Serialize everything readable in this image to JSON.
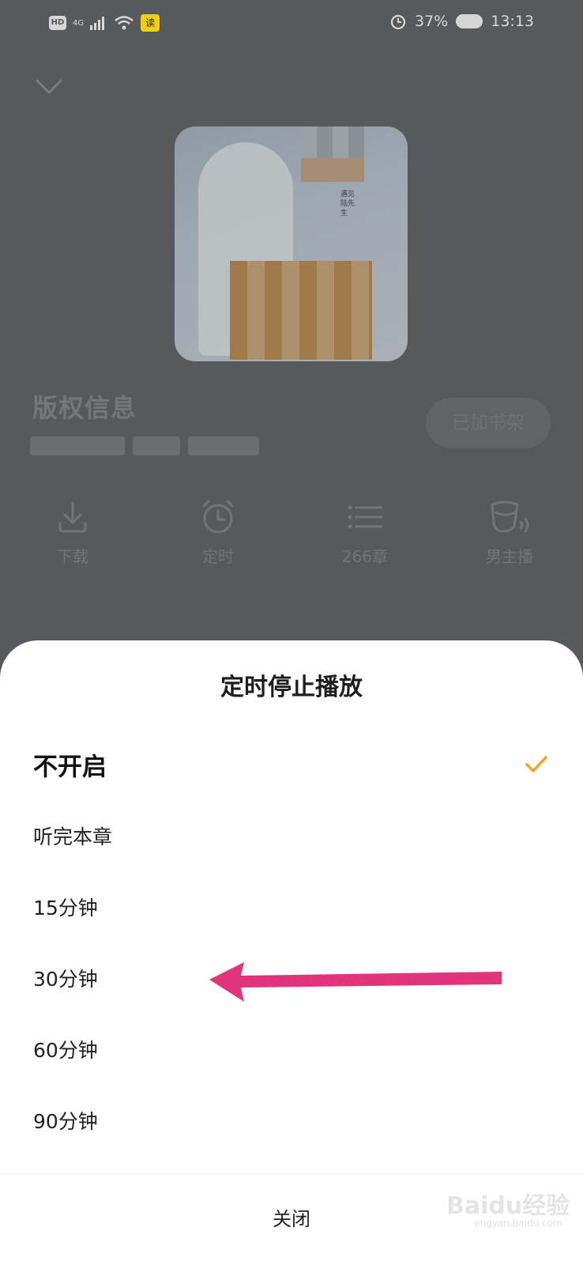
{
  "status_bar": {
    "hd_label": "HD",
    "network_label": "4G",
    "app_badge": "读",
    "battery_percent": "37%",
    "time": "13:13"
  },
  "player": {
    "cover_title_lines": [
      "遇见",
      "陆先生"
    ],
    "book_title": "版权信息",
    "shelf_button": "已加书架",
    "actions": [
      {
        "label": "下载",
        "icon": "download-icon"
      },
      {
        "label": "定时",
        "icon": "alarm-clock-icon"
      },
      {
        "label": "266章",
        "icon": "chapter-list-icon"
      },
      {
        "label": "男主播",
        "icon": "narrator-icon"
      }
    ]
  },
  "timer_sheet": {
    "title": "定时停止播放",
    "options": [
      {
        "label": "不开启",
        "selected": true
      },
      {
        "label": "听完本章",
        "selected": false
      },
      {
        "label": "15分钟",
        "selected": false
      },
      {
        "label": "30分钟",
        "selected": false
      },
      {
        "label": "60分钟",
        "selected": false
      },
      {
        "label": "90分钟",
        "selected": false
      }
    ],
    "close_label": "关闭"
  },
  "watermark": {
    "main": "Baidu经验",
    "sub": "jingyan.baidu.com"
  },
  "colors": {
    "accent": "#f0a32a",
    "annotation_arrow": "#e2347a",
    "overlay": "#58595b"
  }
}
